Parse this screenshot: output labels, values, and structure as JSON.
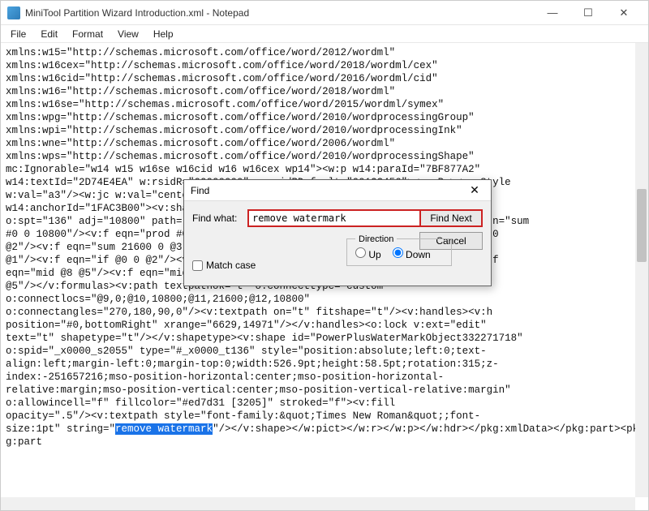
{
  "titlebar": {
    "title": "MiniTool Partition Wizard Introduction.xml - Notepad"
  },
  "menus": [
    "File",
    "Edit",
    "Format",
    "View",
    "Help"
  ],
  "xml_body_pre": "xmlns:w15=\"http://schemas.microsoft.com/office/word/2012/wordml\"\nxmlns:w16cex=\"http://schemas.microsoft.com/office/word/2018/wordml/cex\"\nxmlns:w16cid=\"http://schemas.microsoft.com/office/word/2016/wordml/cid\"\nxmlns:w16=\"http://schemas.microsoft.com/office/word/2018/wordml\"\nxmlns:w16se=\"http://schemas.microsoft.com/office/word/2015/wordml/symex\"\nxmlns:wpg=\"http://schemas.microsoft.com/office/word/2010/wordprocessingGroup\"\nxmlns:wpi=\"http://schemas.microsoft.com/office/word/2010/wordprocessingInk\"\nxmlns:wne=\"http://schemas.microsoft.com/office/word/2006/wordml\"\nxmlns:wps=\"http://schemas.microsoft.com/office/word/2010/wordprocessingShape\"\nmc:Ignorable=\"w14 w15 w16se w16cid w16 w16cex wp14\"><w:p w14:paraId=\"7BF877A2\"\nw14:textId=\"2D74E4EA\" w:rsidR=\"00000000\" w:rsidRDefault=\"00123456\"><w:pPr><w:pStyle\nw:val=\"a3\"/><w:jc w:val=\"center\"/></w:pPr><w:r><w:pict\nw14:anchorId=\"1FAC3B00\"><v:shapetype id=\"_x0000_t136\" coordsize=\"21600,21600\"\no:spt=\"136\" adj=\"10800\" path=\"m@7,0l@8,0m@5,21600l@6,21600e\"><v:formulas><v:f eqn=\"sum\n#0 0 10800\"/><v:f eqn=\"prod #0 2 1\"/><v:f eqn=\"sum 21600 0 @1\"/><v:f eqn=\"sum 0 0\n@2\"/><v:f eqn=\"sum 21600 0 @3\"/><v:f eqn=\"if @0 @3 0\"/><v:f eqn=\"if @0 21600\n@1\"/><v:f eqn=\"if @0 0 @2\"/><v:f eqn=\"if @0 @4 21600\"/><v:f eqn=\"mid @5 @6\"/><v:f\neqn=\"mid @8 @5\"/><v:f eqn=\"mid @7 @8\"/><v:f eqn=\"mid @6 @7\"/><v:f eqn=\"sum @6 0\n@5\"/></v:formulas><v:path textpathok=\"t\" o:connecttype=\"custom\"\no:connectlocs=\"@9,0;@10,10800;@11,21600;@12,10800\"\no:connectangles=\"270,180,90,0\"/><v:textpath on=\"t\" fitshape=\"t\"/><v:handles><v:h\nposition=\"#0,bottomRight\" xrange=\"6629,14971\"/></v:handles><o:lock v:ext=\"edit\"\ntext=\"t\" shapetype=\"t\"/></v:shapetype><v:shape id=\"PowerPlusWaterMarkObject332271718\"\no:spid=\"_x0000_s2055\" type=\"#_x0000_t136\" style=\"position:absolute;left:0;text-\nalign:left;margin-left:0;margin-top:0;width:526.9pt;height:58.5pt;rotation:315;z-\nindex:-251657216;mso-position-horizontal:center;mso-position-horizontal-\nrelative:margin;mso-position-vertical:center;mso-position-vertical-relative:margin\"\no:allowincell=\"f\" fillcolor=\"#ed7d31 [3205]\" stroked=\"f\"><v:fill\nopacity=\".5\"/><v:textpath style=\"font-family:&quot;Times New Roman&quot;;font-\nsize:1pt\" string=\"",
  "highlight_text": "remove watermark",
  "xml_body_post": "\"/></v:shape></w:pict></w:r></w:p></w:hdr></pkg:xmlData></pkg:part><pkg:part ",
  "find": {
    "title": "Find",
    "label_find_what": "Find what:",
    "input_value": "remove watermark",
    "btn_find_next": "Find Next",
    "btn_cancel": "Cancel",
    "direction_label": "Direction",
    "up_label": "Up",
    "down_label": "Down",
    "match_case_label": "Match case"
  }
}
